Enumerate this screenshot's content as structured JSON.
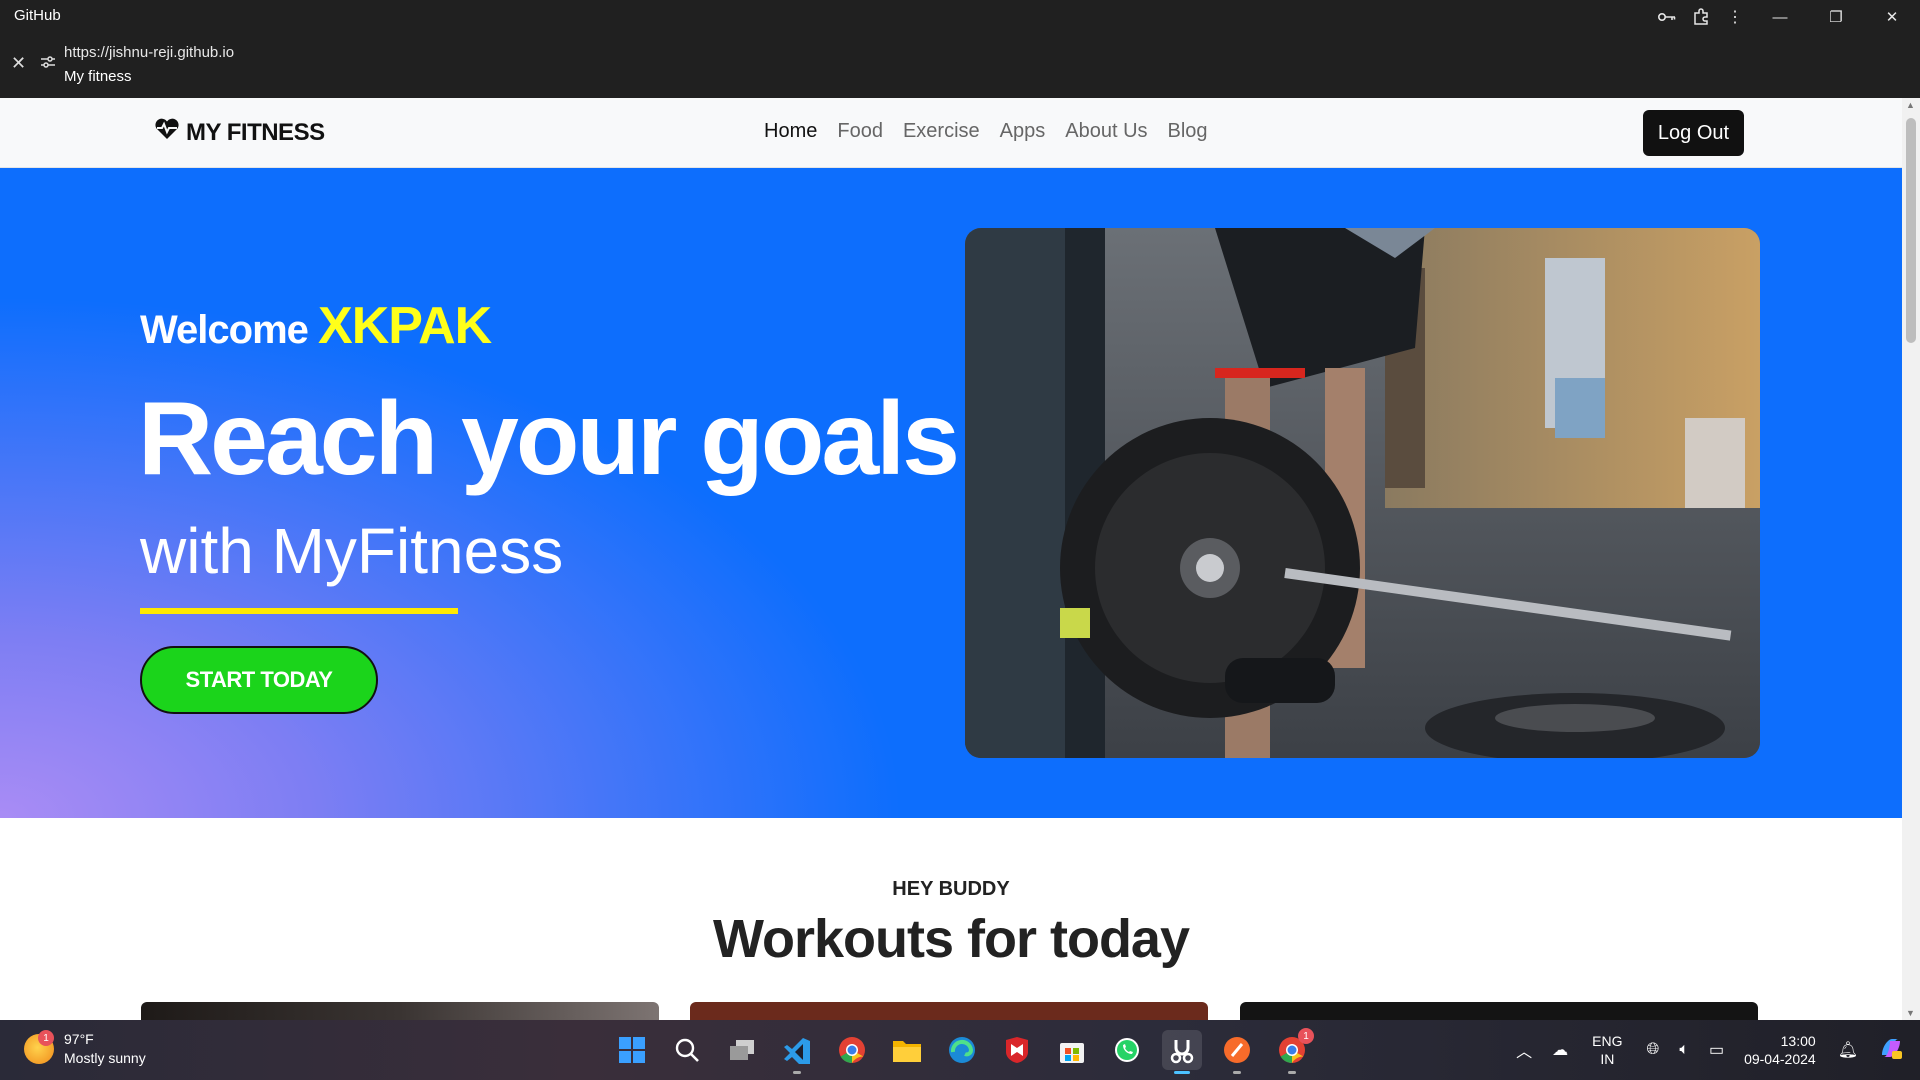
{
  "window": {
    "app_title": "GitHub",
    "url": "https://jishnu-reji.github.io",
    "page_title": "My fitness"
  },
  "navbar": {
    "brand": "MY FITNESS",
    "links": [
      "Home",
      "Food",
      "Exercise",
      "Apps",
      "About Us",
      "Blog"
    ],
    "active_link": "Home",
    "logout_label": "Log Out"
  },
  "hero": {
    "welcome": "Welcome",
    "username": "XKPAK",
    "headline": "Reach your goals",
    "subline": "with MyFitness",
    "cta_label": "START TODAY"
  },
  "section": {
    "eyebrow": "HEY BUDDY",
    "title": "Workouts for today"
  },
  "taskbar": {
    "weather_temp": "97°F",
    "weather_desc": "Mostly sunny",
    "weather_badge": "1",
    "lang_top": "ENG",
    "lang_bottom": "IN",
    "time": "13:00",
    "date": "09-04-2024",
    "chrome_badge": "1"
  },
  "colors": {
    "hero_blue": "#0d6efd",
    "accent_yellow": "#ffff1a",
    "cta_green": "#1bd41b"
  }
}
